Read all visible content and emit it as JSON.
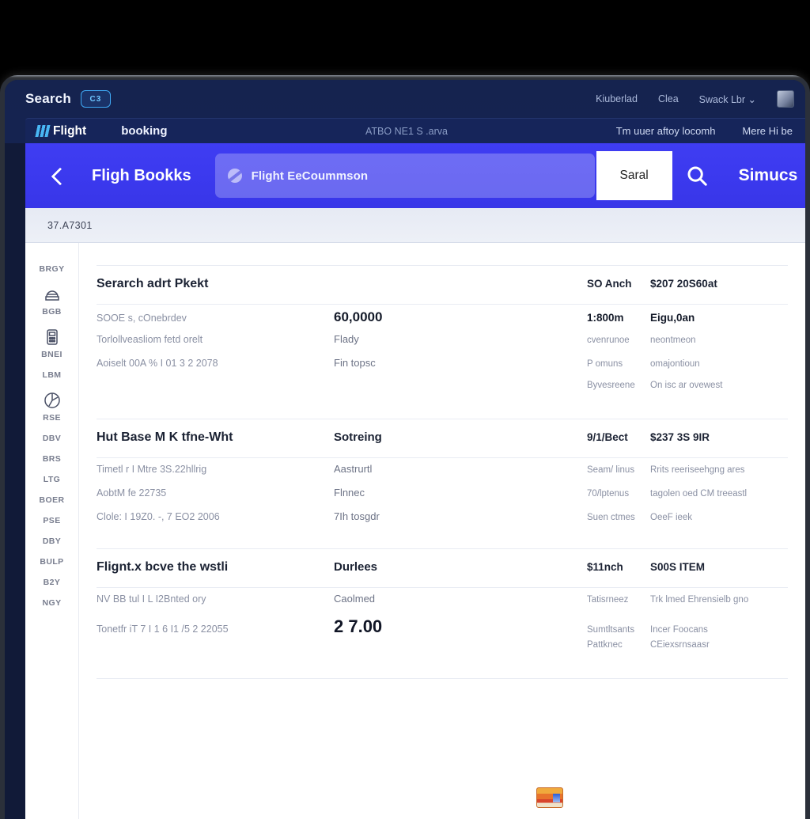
{
  "header": {
    "search_label": "Search",
    "search_badge": "C3",
    "top_links": [
      "Kiuberlad",
      "Clea",
      "Swack Lbr"
    ],
    "avatar": "user-avatar",
    "brand": "Flight",
    "nav_booking": "booking",
    "sub_mid": "ATBO NE1 S .arva",
    "sub_right": [
      "Tm uuer aftoy locomh",
      "Mere Hi be"
    ]
  },
  "searchband": {
    "back": "back-arrow",
    "title": "Fligh Bookks",
    "field_value": "Flight EeCoummson",
    "submit_label": "Saral",
    "glass": "search-icon",
    "status": "Simucs"
  },
  "breadcrumb": {
    "text": "37.A7301"
  },
  "sidebar": {
    "items": [
      {
        "label": "BRGY",
        "icon": "none"
      },
      {
        "label": "BGB",
        "icon": "dome"
      },
      {
        "label": "BNEI",
        "icon": "calculator"
      },
      {
        "label": "LBM",
        "icon": "none"
      },
      {
        "label": "RSE",
        "icon": "pie"
      },
      {
        "label": "DBV",
        "icon": "none"
      },
      {
        "label": "BRS",
        "icon": "none"
      },
      {
        "label": "LTG",
        "icon": "none"
      },
      {
        "label": "BOER",
        "icon": "none"
      },
      {
        "label": "PSE",
        "icon": "none"
      },
      {
        "label": "DBY",
        "icon": "none"
      },
      {
        "label": "BULP",
        "icon": "none"
      },
      {
        "label": "B2Y",
        "icon": "none"
      },
      {
        "label": "NGY",
        "icon": "none"
      }
    ]
  },
  "content": {
    "sections": [
      {
        "head": {
          "title": "Serarch adrt Pkekt",
          "mid": "",
          "col_a": "SO Anch",
          "col_b": "$207 20S60at"
        },
        "rows": [
          {
            "c1": "SOOE s, cOnebrdev",
            "c2": "60,0000",
            "c2style": "big",
            "c3": "1:800m",
            "c3style": "dark",
            "c4": "Eigu,0an",
            "c4style": "dark"
          },
          {
            "c1": "Torlollveasliom fetd orelt",
            "c2": "Flady",
            "c2style": "",
            "c3": "cvenrunoe",
            "c3style": "",
            "c4": "neontmeon",
            "c4style": ""
          },
          {
            "c1": "Aoiselt 00A % I 01 3 2 2078",
            "c2": "Fin topsc",
            "c2style": "",
            "c3": "P omuns",
            "c3style": "",
            "c4": "omajontioun",
            "c4style": ""
          },
          {
            "c1": "",
            "c2": "",
            "c2style": "",
            "c3": "Byvesreene",
            "c3style": "",
            "c4": "On isc ar ovewest",
            "c4style": ""
          }
        ]
      },
      {
        "head": {
          "title": "Hut Base M K tfne-Wht",
          "mid": "Sotreing",
          "col_a": "9/1/Bect",
          "col_b": "$237 3S 9IR"
        },
        "rows": [
          {
            "c1": "Timetl r I Mtre 3S.22hllrig",
            "c2": "Aastrurtl",
            "c2style": "",
            "c3": "Seam/ linus",
            "c3style": "",
            "c4": "Rrits reeriseehgng ares",
            "c4style": ""
          },
          {
            "c1": "AobtM fe 22735",
            "c2": "Flnnec",
            "c2style": "",
            "c3": "70/lptenus",
            "c3style": "",
            "c4": "tagolen oed CM treeastl",
            "c4style": ""
          },
          {
            "c1": "Clole: I 19Z0. -, 7 EO2 2006",
            "c2": "7Ih tosgdr",
            "c2style": "",
            "c3": "Suen ctmes",
            "c3style": "",
            "c4": "OeeF ieek",
            "c4style": ""
          }
        ]
      },
      {
        "head": {
          "title": "Flignt.x bcve the wstli",
          "mid": "Durlees",
          "col_a": "$11nch",
          "col_b": "S00S ITEM"
        },
        "rows": [
          {
            "c1": "NV BB tul I L I2Bnted ory",
            "c2": "Caolmed",
            "c2style": "",
            "c3": "Tatisrneez",
            "c3style": "",
            "c4": "Trk lmed Ehrensielb gno",
            "c4style": ""
          },
          {
            "c1": "Tonetfr iT 7 I 1 6 I1 /5 2 22055",
            "c2": "2 7.00",
            "c2style": "huge",
            "c3": "Sumtltsants",
            "c3style": "",
            "c4": "Incer Foocans",
            "c4style": ""
          },
          {
            "c1": "",
            "c2": "",
            "c2style": "",
            "c3": "Pattknec",
            "c3style": "",
            "c4": "CEiexsrnsaasr",
            "c4style": ""
          }
        ]
      }
    ],
    "thumbnail": "thumbnail-card"
  }
}
